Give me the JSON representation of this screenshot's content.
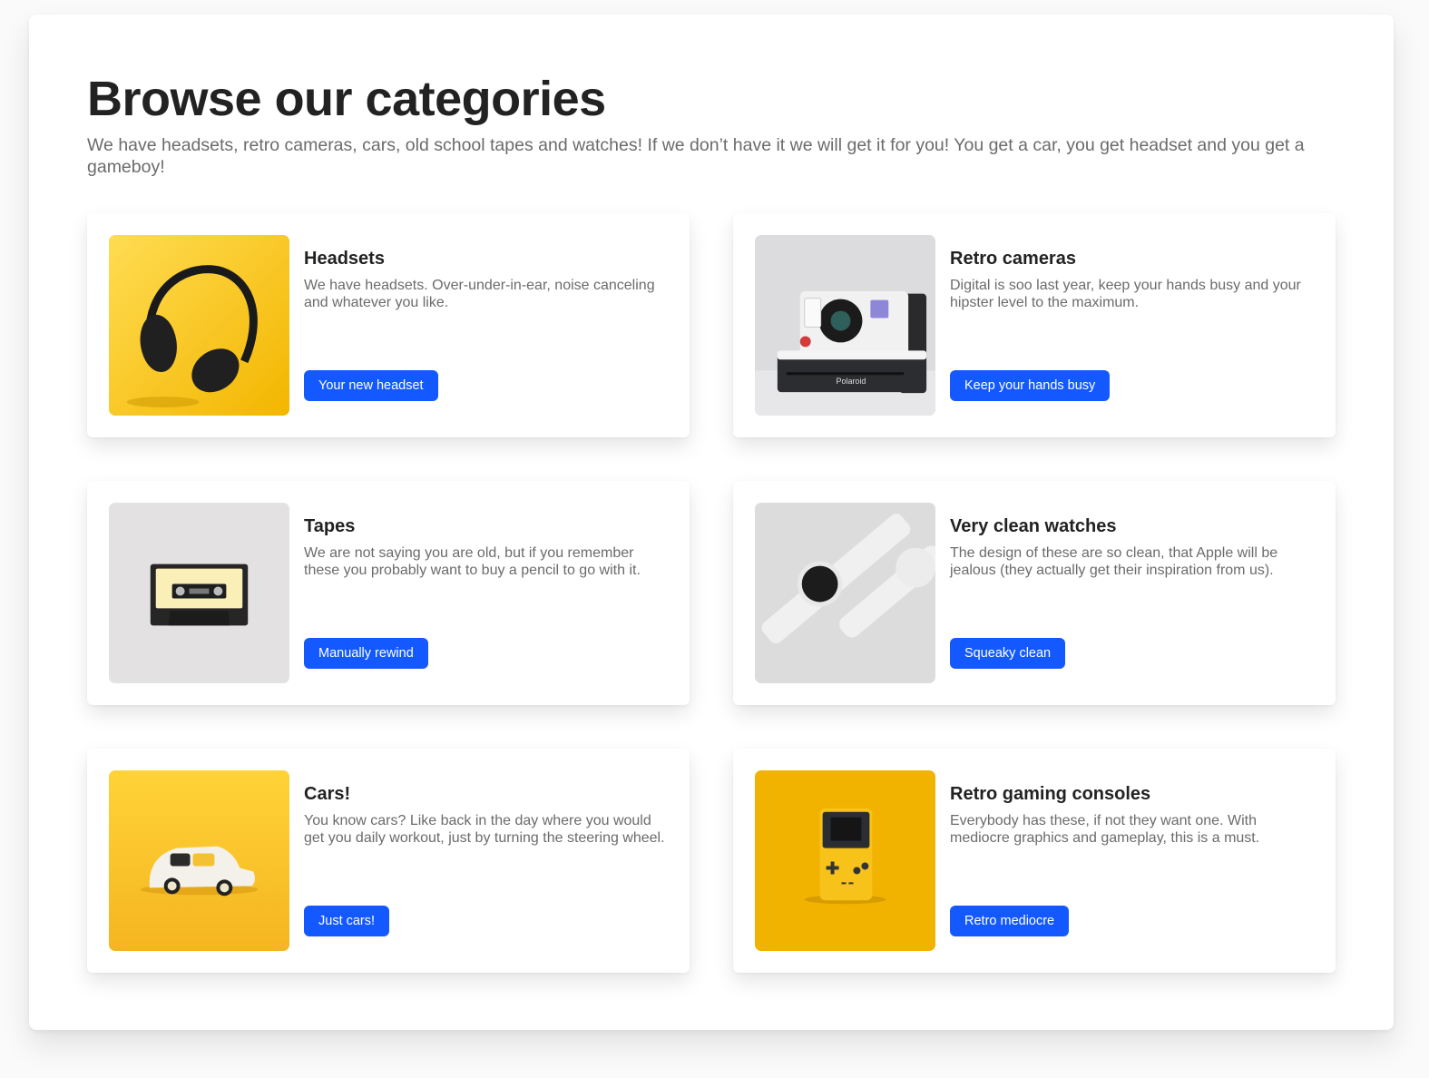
{
  "header": {
    "title": "Browse our categories",
    "intro": "We have headsets, retro cameras, cars, old school tapes and watches! If we don’t have it we will get it for you! You get a car, you get headset and you get a gameboy!"
  },
  "theme": {
    "accent": "#1359ff",
    "title_color": "#222222",
    "text_color": "#6b6b6b"
  },
  "categories": [
    {
      "title": "Headsets",
      "description": "We have headsets. Over-under-in-ear, noise canceling and whatever you like.",
      "button": "Your new headset",
      "image": "headphones-photo"
    },
    {
      "title": "Retro cameras",
      "description": "Digital is soo last year, keep your hands busy and your hipster level to the maximum.",
      "button": "Keep your hands busy",
      "image": "polaroid-camera-photo"
    },
    {
      "title": "Tapes",
      "description": "We are not saying you are old, but if you remember these you probably want to buy a pencil to go with it.",
      "button": "Manually rewind",
      "image": "cassette-tape-photo"
    },
    {
      "title": "Very clean watches",
      "description": "The design of these are so clean, that Apple will be jealous (they actually get their inspiration from us).",
      "button": "Squeaky clean",
      "image": "white-watches-photo"
    },
    {
      "title": "Cars!",
      "description": "You know cars? Like back in the day where you would get you daily workout, just by turning the steering wheel.",
      "button": "Just cars!",
      "image": "toy-car-photo"
    },
    {
      "title": "Retro gaming consoles",
      "description": "Everybody has these, if not they want one. With mediocre graphics and gameplay, this is a must.",
      "button": "Retro mediocre",
      "image": "gameboy-photo"
    }
  ]
}
